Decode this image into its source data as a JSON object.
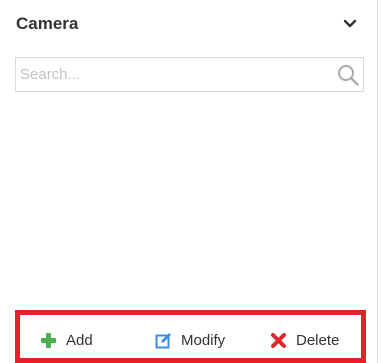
{
  "panel": {
    "title": "Camera",
    "toggle_icon": "chevron-down-icon"
  },
  "search": {
    "placeholder": "Search...",
    "value": "",
    "icon": "search-icon"
  },
  "camera_list": {
    "items": []
  },
  "toolbar": {
    "add_label": "Add",
    "add_icon": "plus-icon",
    "modify_label": "Modify",
    "modify_icon": "edit-icon",
    "delete_label": "Delete",
    "delete_icon": "close-icon",
    "highlight_color": "#e8202a"
  },
  "colors": {
    "add_icon": "#4cae4c",
    "modify_icon": "#3d8ee0",
    "delete_icon": "#e0262d"
  }
}
